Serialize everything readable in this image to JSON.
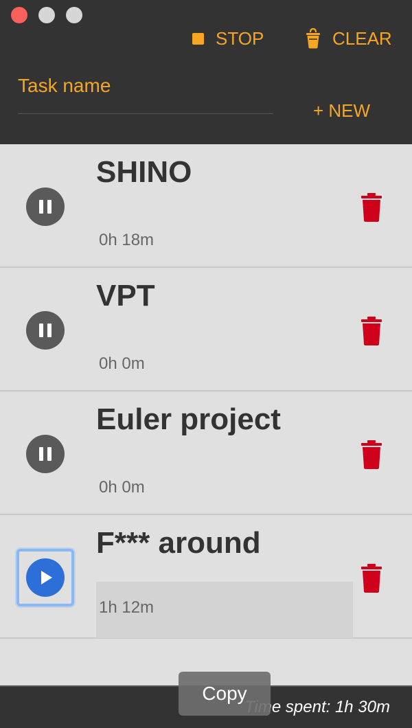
{
  "window": {
    "controls": [
      "close",
      "minimize",
      "maximize"
    ]
  },
  "toolbar": {
    "stop_label": "STOP",
    "clear_label": "CLEAR",
    "stop_icon": "stop-square-icon",
    "clear_icon": "bucket-icon"
  },
  "new_task": {
    "placeholder": "Task name",
    "value": "",
    "new_label": "+ NEW"
  },
  "tasks": [
    {
      "name": "SHINO",
      "time": "0h 18m",
      "state": "running",
      "toggle_icon": "pause-icon"
    },
    {
      "name": "VPT",
      "time": "0h 0m",
      "state": "running",
      "toggle_icon": "pause-icon"
    },
    {
      "name": "Euler project",
      "time": "0h 0m",
      "state": "running",
      "toggle_icon": "pause-icon"
    },
    {
      "name": "F*** around",
      "time": "1h 12m",
      "state": "paused",
      "toggle_icon": "play-icon"
    }
  ],
  "footer": {
    "total_label": "Time spent: 1h 30m"
  },
  "tooltip": {
    "copy_label": "Copy"
  },
  "colors": {
    "accent": "#f5a623",
    "header_bg": "#333333",
    "list_bg": "#e0e0e0",
    "delete": "#d0021b",
    "play_active": "#2c6fd9",
    "pause": "#5a5a5a"
  }
}
